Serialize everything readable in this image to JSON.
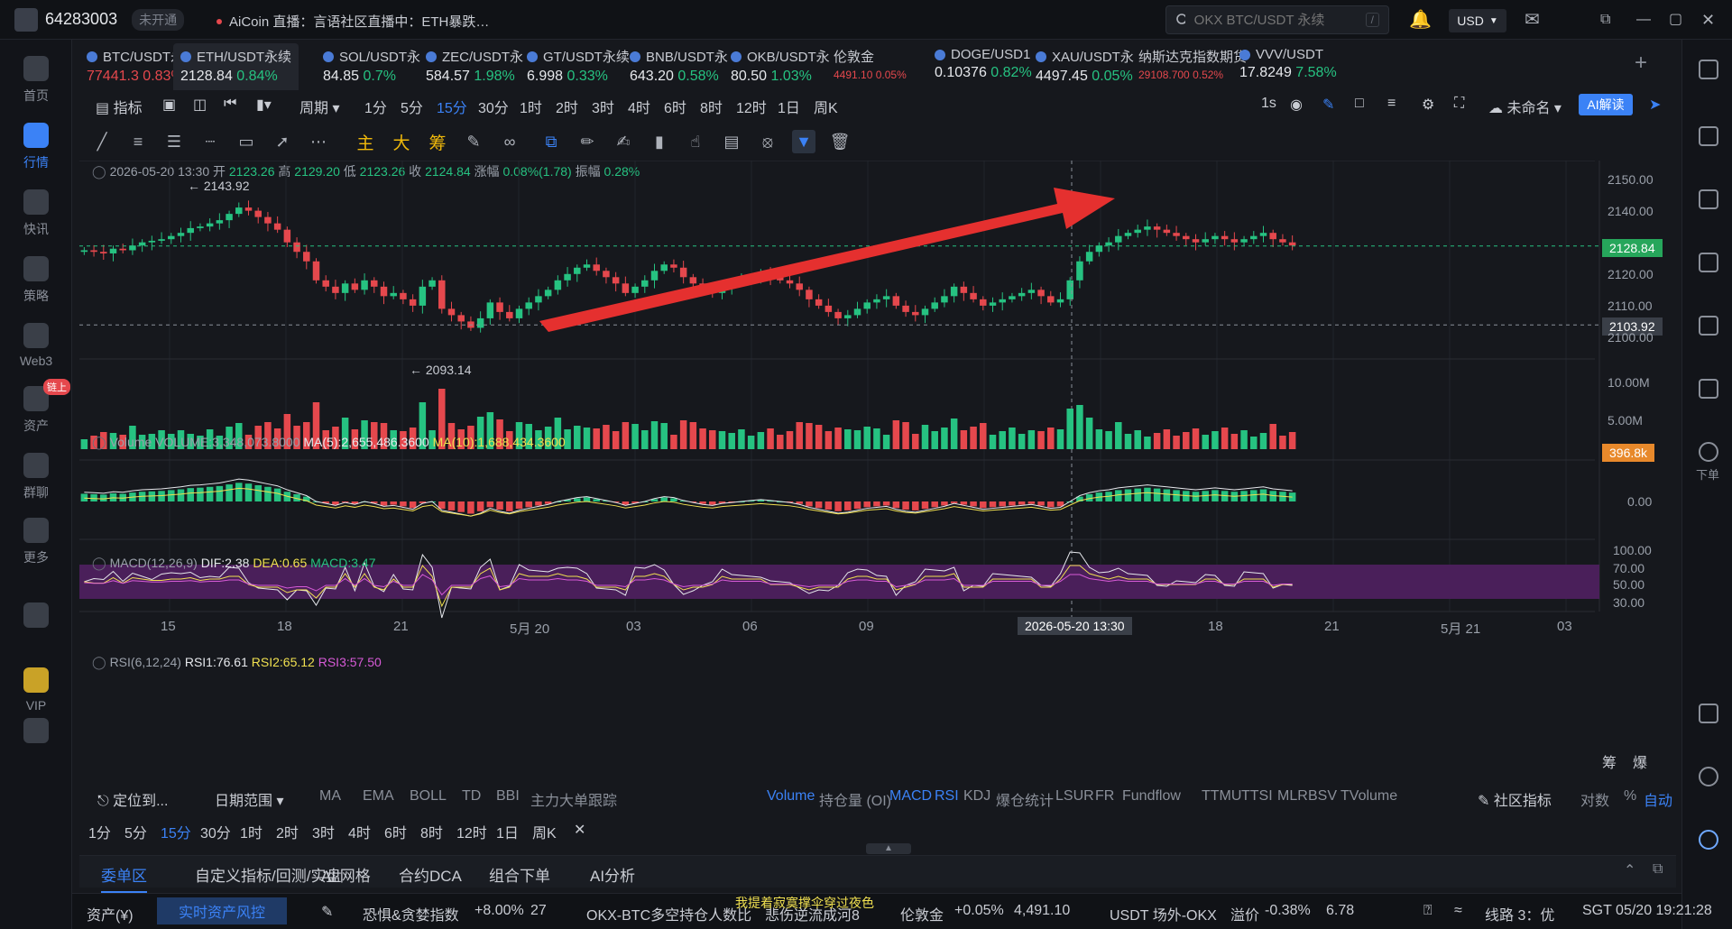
{
  "topbar": {
    "account_id": "64283003",
    "account_status": "未开通",
    "live_text": "AiCoin 直播：言语社区直播中：ETH暴跌…",
    "search_placeholder": "OKX BTC/USDT 永续",
    "search_shortcut": "/",
    "currency": "USD"
  },
  "sidebar": {
    "items": [
      {
        "label": "首页",
        "icon": "home-icon"
      },
      {
        "label": "行情",
        "icon": "market-icon",
        "active": true
      },
      {
        "label": "快讯",
        "icon": "news-icon"
      },
      {
        "label": "策略",
        "icon": "robot-icon"
      },
      {
        "label": "Web3",
        "icon": "web3-icon"
      },
      {
        "label": "资产",
        "icon": "wallet-icon",
        "badge": "链上"
      },
      {
        "label": "群聊",
        "icon": "chat-icon"
      },
      {
        "label": "更多",
        "icon": "grid-icon"
      },
      {
        "label": "",
        "icon": "phone-icon"
      },
      {
        "label": "VIP",
        "icon": "diamond-icon"
      },
      {
        "label": "",
        "icon": "settings-icon"
      }
    ]
  },
  "rightbar": {
    "order_label": "下单"
  },
  "tabs": [
    {
      "name": "BTC/USDT永",
      "price": "77441.3",
      "change": "0.83%",
      "dir": "down"
    },
    {
      "name": "ETH/USDT永续",
      "price": "2128.84",
      "change": "0.84%",
      "dir": "up",
      "active": true
    },
    {
      "name": "SOL/USDT永",
      "price": "84.85",
      "change": "0.7%",
      "dir": "up"
    },
    {
      "name": "ZEC/USDT永",
      "price": "584.57",
      "change": "1.98%",
      "dir": "up"
    },
    {
      "name": "GT/USDT永续",
      "price": "6.998",
      "change": "0.33%",
      "dir": "up"
    },
    {
      "name": "BNB/USDT永",
      "price": "643.20",
      "change": "0.58%",
      "dir": "up"
    },
    {
      "name": "OKB/USDT永",
      "price": "80.50",
      "change": "1.03%",
      "dir": "up"
    },
    {
      "name": "伦敦金",
      "price": "4491.10",
      "change": "0.05%",
      "dir": "down",
      "small": true
    },
    {
      "name": "DOGE/USD1",
      "price": "0.10376",
      "change": "0.82%",
      "dir": "up"
    },
    {
      "name": "XAU/USDT永",
      "price": "4497.45",
      "change": "0.05%",
      "dir": "up"
    },
    {
      "name": "纳斯达克指数期货",
      "price": "29108.700",
      "change": "0.52%",
      "dir": "down",
      "small": true
    },
    {
      "name": "VVV/USDT",
      "price": "17.8249",
      "change": "7.58%",
      "dir": "up"
    }
  ],
  "interval_bar": {
    "indicator_label": "指标",
    "period_label": "周期",
    "intervals": [
      "1分",
      "5分",
      "15分",
      "30分",
      "1时",
      "2时",
      "3时",
      "4时",
      "6时",
      "8时",
      "12时",
      "1日",
      "周K"
    ],
    "active_interval": "15分",
    "speed": "1s",
    "layout_name": "未命名",
    "ai_button": "AI解读"
  },
  "drawbar": {
    "text_tools": [
      "主",
      "大",
      "筹"
    ]
  },
  "chart_data": {
    "type": "candlestick",
    "symbol": "ETH/USDT永续",
    "ohlc_header": {
      "datetime": "2026-05-20 13:30",
      "open_label": "开",
      "open": "2123.26",
      "high_label": "高",
      "high": "2129.20",
      "low_label": "低",
      "low": "2123.26",
      "close_label": "收",
      "close": "2124.84",
      "change_label": "涨幅",
      "change": "0.08%(1.78)",
      "amplitude_label": "振幅",
      "amplitude": "0.28%"
    },
    "price_ticks": [
      "2150.00",
      "2140.00",
      "2128.84",
      "2120.00",
      "2110.00",
      "2103.92",
      "2100.00"
    ],
    "price_ylim": [
      2096,
      2153
    ],
    "last_price": "2128.84",
    "crosshair_price": "2103.92",
    "high_mark": "← 2143.92",
    "low_mark": "← 2093.14",
    "x_ticks": [
      "15",
      "18",
      "21",
      "5月 20",
      "03",
      "06",
      "09",
      "12",
      "15",
      "18",
      "21",
      "5月 21",
      "03"
    ],
    "crosshair_time": "2026-05-20 13:30",
    "closes": [
      2127.5,
      2127,
      2126.5,
      2128,
      2127.5,
      2129,
      2130,
      2130.5,
      2131,
      2132,
      2133,
      2134.5,
      2135,
      2136,
      2137,
      2139,
      2141,
      2140,
      2138,
      2136,
      2134,
      2130,
      2127,
      2124,
      2118,
      2116,
      2114,
      2117,
      2115,
      2118,
      2116,
      2113,
      2114,
      2112,
      2110,
      2116,
      2118,
      2109,
      2107,
      2105,
      2103,
      2106,
      2111,
      2108,
      2106,
      2109,
      2111,
      2113,
      2115,
      2118,
      2120,
      2122,
      2123,
      2121,
      2119,
      2117,
      2114,
      2116,
      2118,
      2121,
      2123,
      2122,
      2119,
      2117,
      2115,
      2114,
      2116,
      2117,
      2118,
      2119,
      2120,
      2119,
      2118,
      2117,
      2115,
      2112,
      2110,
      2108,
      2106,
      2107,
      2109,
      2111,
      2112,
      2113,
      2110,
      2108,
      2107,
      2109,
      2111,
      2113,
      2116,
      2114,
      2112,
      2110,
      2111,
      2112,
      2113,
      2114,
      2115,
      2113,
      2111,
      2112,
      2118,
      2124,
      2127,
      2129,
      2130,
      2132,
      2133,
      2134,
      2135,
      2134,
      2133,
      2132,
      2131,
      2130,
      2131,
      2132,
      2131,
      2130,
      2131,
      2132,
      2133,
      2131,
      2130,
      2129
    ],
    "volume_ticks": [
      "10.00M",
      "5.00M",
      "396.8k"
    ],
    "volume_header": {
      "label": "Volume",
      "volume": "VOLUME:3,348,073.8000",
      "ma5": "MA(5):2,655,486.3600",
      "ma10": "MA(10):1,688,434.3600"
    },
    "macd_header": {
      "label": "MACD(12,26,9)",
      "dif": "DIF:2.38",
      "dea": "DEA:0.65",
      "macd": "MACD:3.47"
    },
    "macd_ticks": [
      "0.00"
    ],
    "rsi_header": {
      "label": "RSI(6,12,24)",
      "rsi1": "RSI1:76.61",
      "rsi2": "RSI2:65.12",
      "rsi3": "RSI3:57.50"
    },
    "rsi_ticks": [
      "100.00",
      "70.00",
      "50.00",
      "30.00"
    ],
    "colors": {
      "up": "#26c281",
      "down": "#e5484d",
      "arrow": "#e5302f",
      "rsi_band": "#4a1f5a"
    }
  },
  "indicator_row": {
    "locate": "定位到...",
    "date_range": "日期范围",
    "main_indicators": [
      "MA",
      "EMA",
      "BOLL",
      "TD",
      "BBI",
      "主力大单跟踪"
    ],
    "sub_indicators": [
      {
        "label": "Volume",
        "on": true
      },
      {
        "label": "持仓量 (OI)",
        "on": false
      },
      {
        "label": "MACD",
        "on": true
      },
      {
        "label": "RSI",
        "on": true
      },
      {
        "label": "KDJ",
        "on": false
      },
      {
        "label": "爆仓统计",
        "on": false
      },
      {
        "label": "LSUR",
        "on": false
      },
      {
        "label": "FR",
        "on": false
      },
      {
        "label": "Fundflow",
        "on": false
      },
      {
        "label": "TTMU",
        "on": false
      },
      {
        "label": "TTSI",
        "on": false
      },
      {
        "label": "MLR",
        "on": false
      },
      {
        "label": "BSV",
        "on": false
      },
      {
        "label": "TVolume",
        "on": false
      }
    ],
    "community": "社区指标",
    "log": "对数",
    "percent": "%",
    "auto": "自动",
    "corner_labels": [
      "筹",
      "爆"
    ]
  },
  "interval_row2": {
    "intervals": [
      "1分",
      "5分",
      "15分",
      "30分",
      "1时",
      "2时",
      "3时",
      "4时",
      "6时",
      "8时",
      "12时",
      "1日",
      "周K"
    ],
    "active": "15分"
  },
  "bottom_tabs": [
    "委单区",
    "自定义指标/回测/实盘",
    "AI 网格",
    "合约DCA",
    "组合下单",
    "AI分析"
  ],
  "statusbar": {
    "assets": "资产(¥)",
    "risk": "实时资产风控",
    "fear_greed_label": "恐惧&贪婪指数",
    "fear_greed_change": "+8.00%",
    "fear_greed_value": "27",
    "okx_ratio_label": "OKX-BTC多空持仓人数比",
    "okx_ratio_value": "悲伤逆流成河8",
    "ticker": "我提着寂寞撑伞穿过夜色",
    "gold_label": "伦敦金",
    "gold_change": "+0.05%",
    "gold_value": "4,491.10",
    "otc_label": "USDT 场外-OKX",
    "premium_label": "溢价",
    "premium_value": "-0.38%",
    "otc_value": "6.78",
    "line_label": "线路 3：优",
    "clock": "SGT 05/20 19:21:28"
  }
}
